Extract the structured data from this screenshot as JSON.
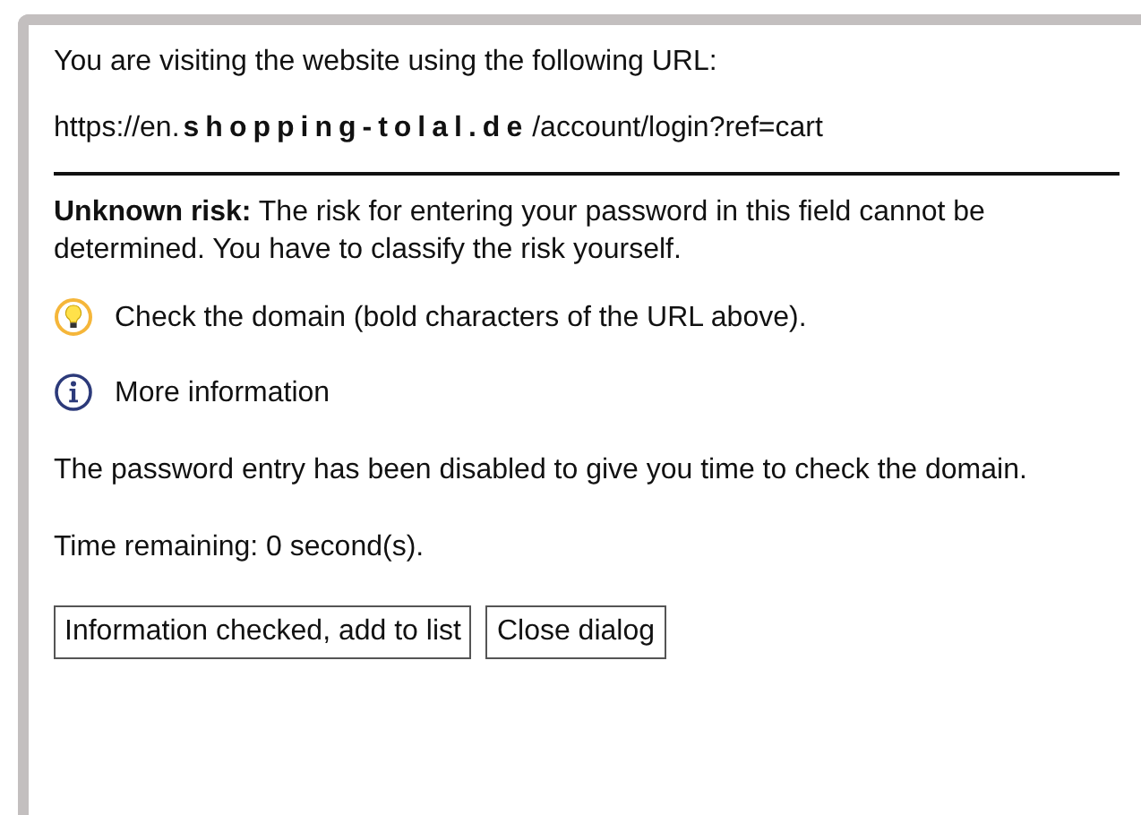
{
  "intro": "You are visiting the website using the following URL:",
  "url": {
    "prefix": "https://en.",
    "domain": "shopping-tolal.de",
    "path": "/account/login?ref=cart"
  },
  "risk_text": "**Unknown risk:** The risk for entering your password in this field cannot be determined. You have to classify the risk yourself.",
  "hints": [
    {
      "kind": "tip",
      "text": "Check the domain (bold characters of the URL above)."
    },
    {
      "kind": "info",
      "text": "More information"
    }
  ],
  "disabled_note": "The password entry has been disabled to give you time to check the domain.",
  "time_remaining": "Time remaining: 0 second(s).",
  "buttons": [
    "Information checked, add to list",
    "Close dialog"
  ]
}
